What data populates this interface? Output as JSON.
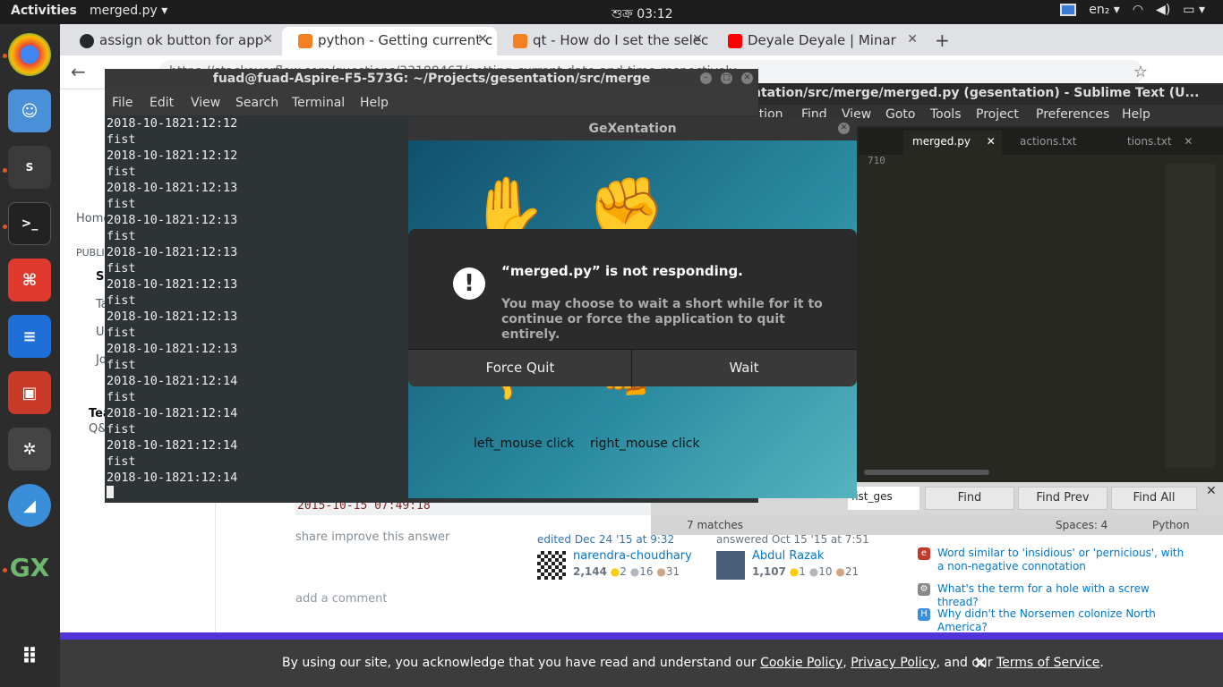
{
  "topbar": {
    "activities": "Activities",
    "app_menu": "merged.py ▾",
    "clock": "শুক্র 03:12",
    "lang": "en₂ ▾"
  },
  "browser": {
    "tabs": [
      {
        "label": "assign ok button for app",
        "fav_color": "#24292e"
      },
      {
        "label": "python - Getting current c",
        "fav_color": "#f48024"
      },
      {
        "label": "qt - How do I set the selec",
        "fav_color": "#f48024"
      },
      {
        "label": "Deyale Deyale | Minar",
        "fav_color": "#ff0000"
      }
    ],
    "url": "https://stackoverflow.com/questions/33188467/getting-current-date-and-time-respectively"
  },
  "so": {
    "left_nav": {
      "home": "Home",
      "public": "PUBLIC",
      "so": "S",
      "t": "Ta",
      "u": "U",
      "j": "Jo",
      "teams": "Tea",
      "qa": "Q&"
    },
    "code_date": "2015-10-15 07:49:18",
    "share": "share  improve this answer",
    "edited": {
      "title": "edited Dec 24 '15 at 9:32",
      "user": "narendra-choudhary",
      "rep": "2,144",
      "gold": "2",
      "silver": "16",
      "bronze": "31"
    },
    "answered": {
      "title": "answered Oct 15 '15 at 7:51",
      "user": "Abdul Razak",
      "rep": "1,107",
      "gold": "1",
      "silver": "10",
      "bronze": "21"
    },
    "add_comment": "add a comment",
    "related": [
      {
        "text": "Word similar to 'insidious' or 'pernicious', with a non-negative connotation",
        "icon_color": "#c0392b"
      },
      {
        "text": "What's the term for a hole with a screw thread?",
        "icon_color": "#888888"
      },
      {
        "text": "Why didn't the Norsemen colonize North America?",
        "icon_color": "#3b8dde"
      }
    ]
  },
  "cookie": {
    "prefix": "By using our site, you acknowledge that you have read and understand our ",
    "cookie_policy": "Cookie Policy",
    "sep1": ", ",
    "privacy_policy": "Privacy Policy",
    "sep2": ", and our ",
    "terms": "Terms of Service",
    "suffix": "."
  },
  "sublime": {
    "title": "ntation/src/merge/merged.py (gesentation) - Sublime Text (U...",
    "menu": [
      "ction",
      "Find",
      "View",
      "Goto",
      "Tools",
      "Project",
      "Preferences",
      "Help"
    ],
    "tabs": [
      "merged.py",
      "actions.txt",
      "tions.txt"
    ],
    "line_number": "710",
    "find_input": "fist_ges",
    "find_buttons": [
      "Find",
      "Find Prev",
      "Find All"
    ],
    "status_matches": "7 matches",
    "status_spaces": "Spaces: 4",
    "status_syntax": "Python"
  },
  "terminal": {
    "title": "fuad@fuad-Aspire-F5-573G: ~/Projects/gesentation/src/merge",
    "menu": [
      "File",
      "Edit",
      "View",
      "Search",
      "Terminal",
      "Help"
    ],
    "lines": [
      "2018-10-1821:12:12",
      "fist",
      "2018-10-1821:12:12",
      "fist",
      "2018-10-1821:12:13",
      "fist",
      "2018-10-1821:12:13",
      "fist",
      "2018-10-1821:12:13",
      "fist",
      "2018-10-1821:12:13",
      "fist",
      "2018-10-1821:12:13",
      "fist",
      "2018-10-1821:12:13",
      "fist",
      "2018-10-1821:12:14",
      "fist",
      "2018-10-1821:12:14",
      "fist",
      "2018-10-1821:12:14",
      "fist",
      "2018-10-1821:12:14"
    ]
  },
  "gex": {
    "title": "GeXentation",
    "left_label": "left_mouse click",
    "right_label": "right_mouse click"
  },
  "dialog": {
    "title": "“merged.py” is not responding.",
    "body": "You may choose to wait a short while for it to continue or force the application to quit entirely.",
    "force_quit": "Force Quit",
    "wait": "Wait"
  }
}
